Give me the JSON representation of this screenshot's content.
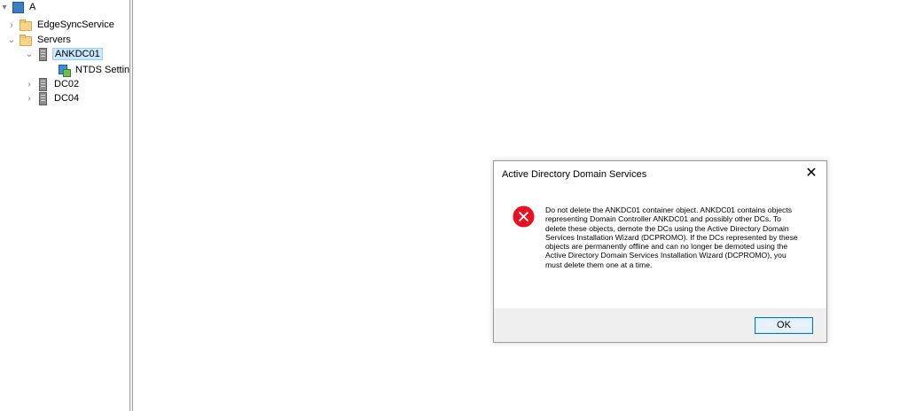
{
  "tree": {
    "items": [
      {
        "label": "A"
      },
      {
        "label": "EdgeSyncService"
      },
      {
        "label": "Servers"
      },
      {
        "label": "ANKDC01"
      },
      {
        "label": "NTDS Settings"
      },
      {
        "label": "DC02"
      },
      {
        "label": "DC04"
      }
    ]
  },
  "dialog": {
    "title": "Active Directory Domain Services",
    "close_glyph": "✕",
    "icon": "error-icon",
    "message": "Do not delete the ANKDC01 container object. ANKDC01 contains objects representing Domain Controller ANKDC01 and possibly other DCs. To delete these objects, demote the DCs using the Active Directory Domain Services Installation Wizard (DCPROMO). If the DCs represented by these objects are permanently offline and can no longer be demoted using the Active Directory Domain Services Installation Wizard (DCPROMO), you must delete them one at a time.",
    "ok_label": "OK",
    "colors": {
      "error": "#e81123",
      "accent": "#0078d7",
      "selection": "#cce8ff"
    }
  }
}
